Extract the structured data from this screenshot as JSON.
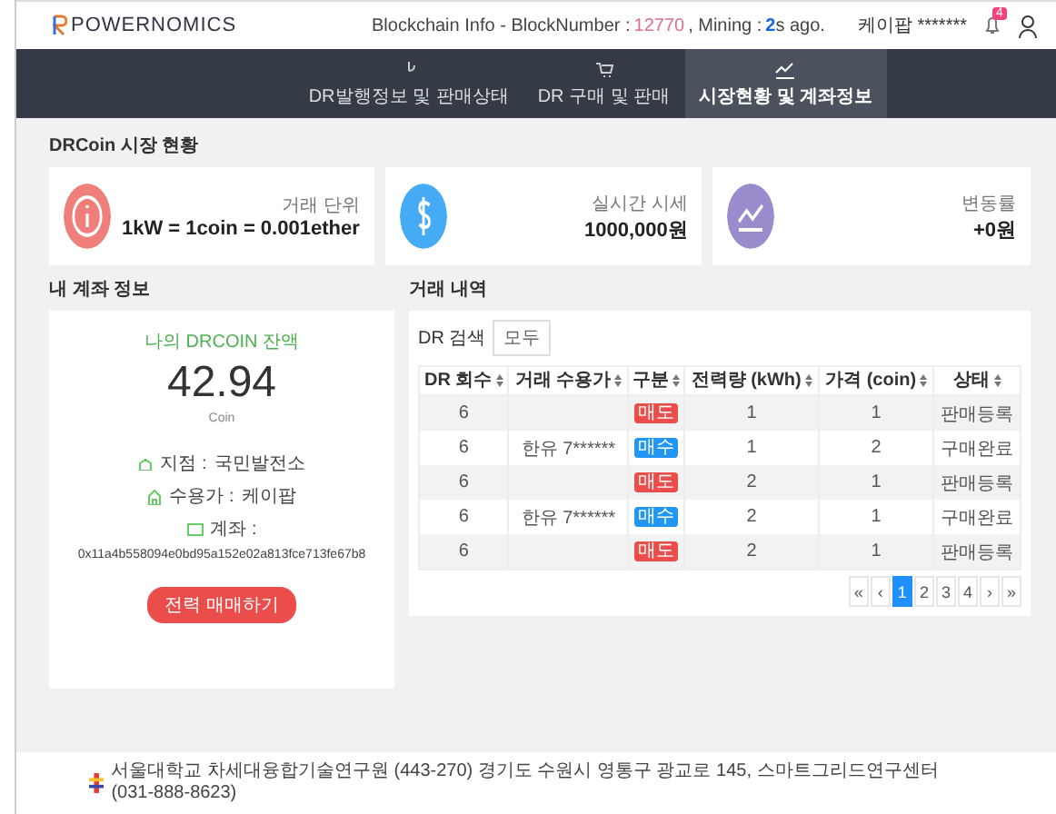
{
  "header": {
    "logo": "POWERNOMICS",
    "blockchain_label": "Blockchain Info - BlockNumber :",
    "block_number": "12770",
    "mining_label": ", Mining :",
    "mining_value": "**2**s ago.",
    "user": "케이팝 *******",
    "notification_count": "4"
  },
  "nav": [
    {
      "label": "DR발행정보 및 판매상태",
      "selected": false
    },
    {
      "label": "DR 구매 및 판매",
      "selected": false
    },
    {
      "label": "시장현황 및 계좌정보",
      "selected": true
    }
  ],
  "market": {
    "title": "DRCoin 시장 현황",
    "cards": [
      {
        "label": "거래 단위",
        "value": "1kW = 1coin = 0.001ether",
        "color": "#f07f7c"
      },
      {
        "label": "실시간 시세",
        "value": "1000,000원",
        "color": "#45abf5"
      },
      {
        "label": "변동률",
        "value": "+0원",
        "color": "#9a8ccc"
      }
    ]
  },
  "account": {
    "title": "내 계좌 정보",
    "balance_label": "나의 DRCOIN 잔액",
    "balance": "42.94",
    "unit": "Coin",
    "plant_label": "지점 :",
    "plant": "국민발전소",
    "consumer_label": "수용가 :",
    "consumer": "케이팝",
    "account_label": "계좌 :",
    "address": "0x11a4b558094e0bd95a152e02a813fce713fe67b8",
    "button": "전력 매매하기"
  },
  "history": {
    "title": "거래 내역",
    "search_label": "DR 검색",
    "search_value": "모두",
    "columns": [
      "DR 회수",
      "거래 수용가",
      "구분",
      "전력량 (kWh)",
      "가격 (coin)",
      "상태"
    ],
    "rows": [
      {
        "round": "6",
        "tag": {
          "label": "매도",
          "color": "#ea4d4a"
        },
        "amount": "1",
        "price": "1",
        "status": "판매등록"
      },
      {
        "round": "6",
        "consumer": "한유 7******",
        "tag": {
          "label": "매수",
          "color": "#2196f3"
        },
        "amount": "1",
        "price": "2",
        "status": "구매완료"
      },
      {
        "round": "6",
        "tag": {
          "label": "매도",
          "color": "#ea4d4a"
        },
        "amount": "2",
        "price": "1",
        "status": "판매등록"
      },
      {
        "round": "6",
        "consumer": "한유 7******",
        "tag": {
          "label": "매수",
          "color": "#2196f3"
        },
        "amount": "2",
        "price": "1",
        "status": "구매완료"
      },
      {
        "round": "6",
        "tag": {
          "label": "매도",
          "color": "#ea4d4a"
        },
        "amount": "2",
        "price": "1",
        "status": "판매등록"
      }
    ],
    "pagination": [
      {
        "label": "«",
        "selected": false
      },
      {
        "label": "‹",
        "selected": false
      },
      {
        "label": "1",
        "selected": true
      },
      {
        "label": "2",
        "selected": false
      },
      {
        "label": "3",
        "selected": false
      },
      {
        "label": "4",
        "selected": false
      },
      {
        "label": "›",
        "selected": false
      },
      {
        "label": "»",
        "selected": false
      }
    ]
  },
  "footer": {
    "text": "서울대학교 차세대융합기술연구원 (443-270) 경기도 수원시 영통구 광교로 145, 스마트그리드연구센터 (031-888-8623)"
  }
}
